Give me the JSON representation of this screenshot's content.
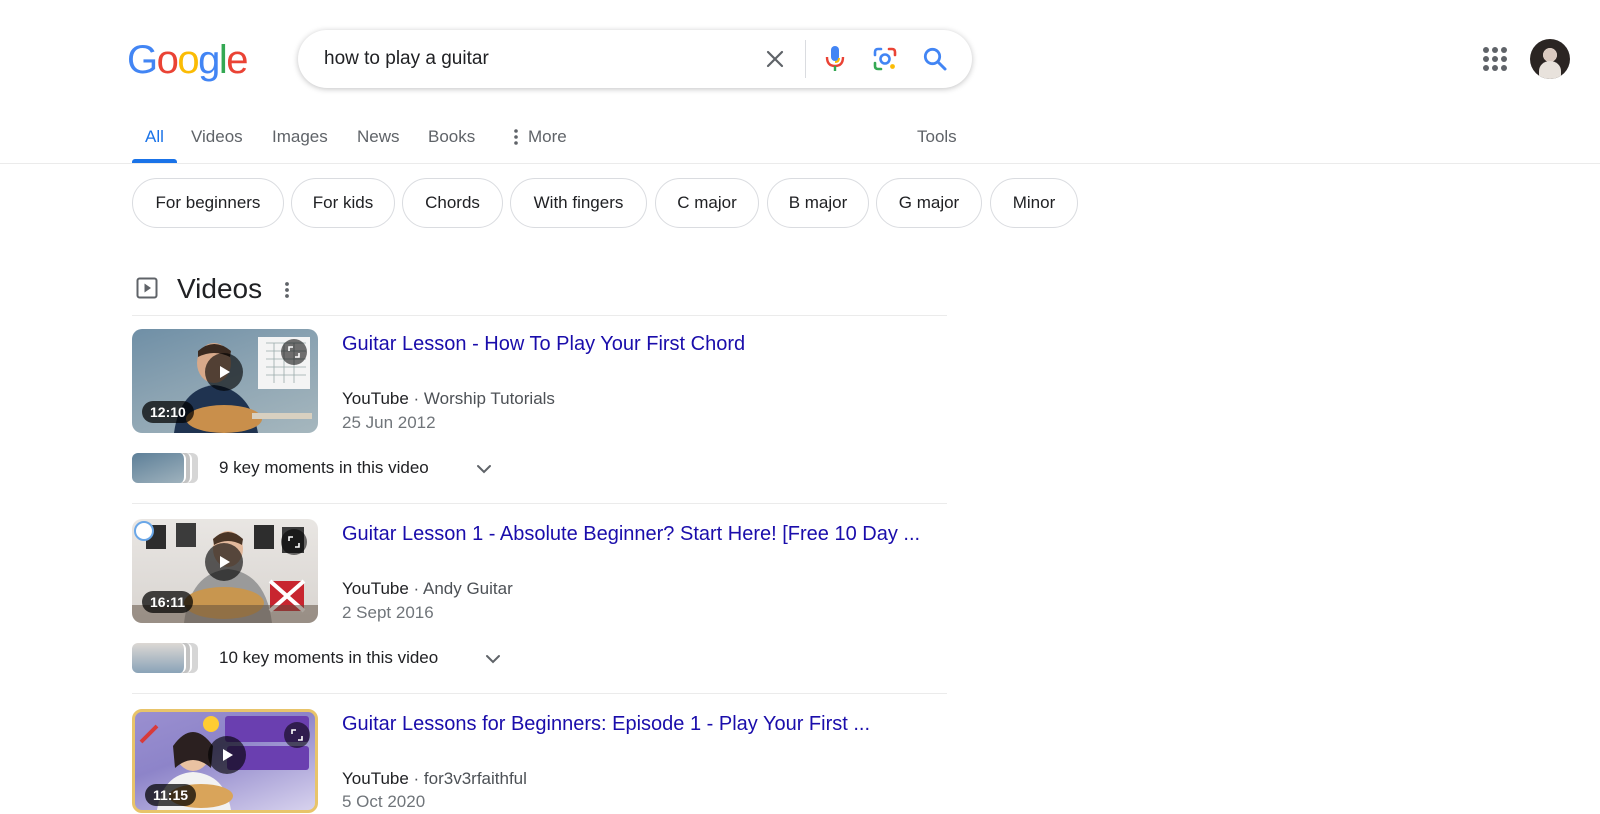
{
  "header": {
    "logo_letters": [
      "G",
      "o",
      "o",
      "g",
      "l",
      "e"
    ],
    "logo_colors": [
      "#4285F4",
      "#EA4335",
      "#FBBC05",
      "#4285F4",
      "#34A853",
      "#EA4335"
    ],
    "search_query": "how to play a guitar",
    "icons": [
      "close-icon",
      "microphone-icon",
      "google-lens-icon",
      "search-icon",
      "apps-grid-icon"
    ]
  },
  "tabs": {
    "items": [
      "All",
      "Videos",
      "Images",
      "News",
      "Books",
      "More"
    ],
    "active": "All",
    "tools_label": "Tools"
  },
  "chips": [
    "For beginners",
    "For kids",
    "Chords",
    "With fingers",
    "C major",
    "B major",
    "G major",
    "Minor"
  ],
  "videos": {
    "heading": "Videos",
    "items": [
      {
        "title": "Guitar Lesson - How To Play Your First Chord",
        "site": "YouTube",
        "channel": "Worship Tutorials",
        "date": "25 Jun 2012",
        "duration": "12:10",
        "key_moments": "9 key moments in this video"
      },
      {
        "title": "Guitar Lesson 1 - Absolute Beginner? Start Here! [Free 10 Day ...",
        "site": "YouTube",
        "channel": "Andy Guitar",
        "date": "2 Sept 2016",
        "duration": "16:11",
        "key_moments": "10 key moments in this video"
      },
      {
        "title": "Guitar Lessons for Beginners: Episode 1 - Play Your First ...",
        "site": "YouTube",
        "channel": "for3v3rfaithful",
        "date": "5 Oct 2020",
        "duration": "11:15"
      }
    ]
  },
  "colors": {
    "accent_blue": "#1a73e8",
    "link": "#1a0dab"
  }
}
